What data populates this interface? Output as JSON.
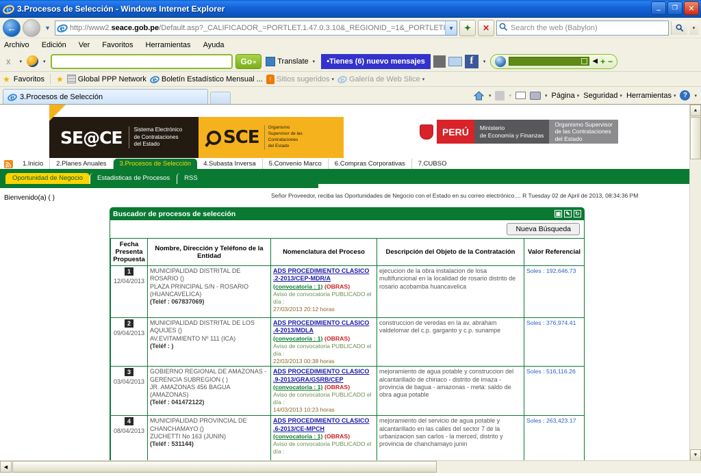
{
  "window": {
    "title": "3.Procesos de Selección - Windows Internet Explorer",
    "minimize": "—",
    "maximize": "❐",
    "close": "✕"
  },
  "address": {
    "url_prefix": "http://www2.",
    "url_domain": "seace.gob.pe",
    "url_suffix": "/Default.asp?_CALIFICADOR_=PORTLET.1.47.0.3.10&_REGIONID_=1&_PORTLETI",
    "refresh_glyph": "✦",
    "stop_glyph": "✕",
    "dropdown_glyph": "▼"
  },
  "search": {
    "placeholder": "Search the web (Babylon)",
    "go_glyph": "🔍",
    "dropdown_glyph": "▾"
  },
  "menubar": [
    "Archivo",
    "Edición",
    "Ver",
    "Favoritos",
    "Herramientas",
    "Ayuda"
  ],
  "babylon": {
    "close_label": "x",
    "input_value": "",
    "go_label": "Go",
    "go_chevron": "»",
    "translate_label": "Translate",
    "translate_caret": "▾",
    "messages_label": "•Tienes (6) nuevo mensajes",
    "facebook_label": "f",
    "facebook_caret": "▾",
    "speaker_glyph": "◀",
    "plus_label": "+",
    "minus_label": "−",
    "caret": "▾"
  },
  "favorites": {
    "label": "Favoritos",
    "items": [
      {
        "label": "Global PPP Network",
        "icon": "grid-icon"
      },
      {
        "label": "Boletín Estadístico Mensual ...",
        "icon": "ie-icon"
      },
      {
        "label": "Sitios sugeridos",
        "icon": "bulb-icon",
        "caret": "▾"
      },
      {
        "label": "Galería de Web Slice",
        "icon": "ie-icon",
        "caret": "▾"
      }
    ]
  },
  "tabstrip": {
    "tab_label": "3.Procesos de Selección",
    "commands": [
      {
        "label": "Página",
        "caret": "▾"
      },
      {
        "label": "Seguridad",
        "caret": "▾"
      },
      {
        "label": "Herramientas",
        "caret": "▾"
      }
    ],
    "overflow": "»",
    "help_glyph": "?",
    "caret": "▾"
  },
  "banner": {
    "seace_wordmark": "SE@CE",
    "seace_tagline": "Sistema Electrónico\nde Contrataciones\ndel Estado",
    "osce_wordmark": "SCE",
    "osce_tagline": "Organismo\nSupervisor de las\nContrataciones\ndel Estado",
    "peru_label": "PERÚ",
    "ministry_label": "Ministerio\nde Economía y Finanzas",
    "supervisor_label": "Organismo Supervisor\nde las Contrataciones\ndel Estado"
  },
  "nav": {
    "tabs": [
      {
        "label": "1.Inicio",
        "active": false
      },
      {
        "label": "2.Planes Anuales",
        "active": false
      },
      {
        "label": "3.Procesos de Selección",
        "active": true
      },
      {
        "label": "4.Subasta Inversa",
        "active": false
      },
      {
        "label": "5.Convenio Marco",
        "active": false
      },
      {
        "label": "6.Compras Corporativas",
        "active": false
      },
      {
        "label": "7.CUBSO",
        "active": false
      }
    ],
    "subtabs": [
      {
        "label": "Oportunidad de Negocio",
        "active": true
      },
      {
        "label": "Estadisticas de Procesos",
        "active": false
      },
      {
        "label": "RSS",
        "active": false
      }
    ]
  },
  "welcome": {
    "greeting": "Bienvenido(a) ( )",
    "marquee": "Señor Proveedor, reciba las Oportunidades de Negocio con el Estado en su correo electrónico.... R Tuesday 02 de April de 2013, 08:34:36 PM"
  },
  "panel": {
    "title": "Buscador de procesos de selección",
    "icons": [
      "minimize-panel-icon",
      "edit-panel-icon",
      "refresh-panel-icon"
    ],
    "new_search_label": "Nueva Búsqueda"
  },
  "table": {
    "headers": [
      "Fecha Presenta Propuesta",
      "Nombre, Dirección y Teléfono de la Entidad",
      "Nomenclatura del Proceso",
      "Descripción del Objeto de la Contratación",
      "Valor Referencial"
    ],
    "rows": [
      {
        "num": "1",
        "fecha": "12/04/2013",
        "entidad_nombre": "MUNICIPALIDAD DISTRITAL DE ROSARIO ()",
        "entidad_dir": "PLAZA PRINCIPAL S/N - ROSARIO (HUANCAVELICA)",
        "entidad_tel": "(Teléf : 067837069)",
        "nomenclatura": "ADS PROCEDIMIENTO CLASICO .2-2013/CEP-MDR/A",
        "convocatoria": "(convocatoria : 1)",
        "tipo": "(OBRAS)",
        "aviso": "Aviso de convocatoria PUBLICADO el día :",
        "aviso_fecha": "27/03/2013 20:12 horas",
        "descripcion": "ejecucion de la obra instalacion de losa multifuncional en la localidad de rosario distrito de rosario acobamba huancavelica",
        "valor": "Soles : 192,646.73"
      },
      {
        "num": "2",
        "fecha": "09/04/2013",
        "entidad_nombre": "MUNICIPALIDAD DISTRITAL DE LOS AQUIJES ()",
        "entidad_dir": "AV.EVITAMIENTO Nº 111 (ICA)",
        "entidad_tel": "(Teléf : )",
        "nomenclatura": "ADS PROCEDIMIENTO CLASICO .4-2013/MDLA",
        "convocatoria": "(convocatoria : 1)",
        "tipo": "(OBRAS)",
        "aviso": "Aviso de convocatoria PUBLICADO el día :",
        "aviso_fecha": "22/03/2013 00:38 horas",
        "descripcion": "construccion de veredas en la av. abraham valdelomar del c.p. garganto y c.p. sunampe",
        "valor": "Soles : 376,974.41"
      },
      {
        "num": "3",
        "fecha": "03/04/2013",
        "entidad_nombre": "GOBIERNO REGIONAL DE AMAZONAS - GERENCIA SUBREGION ( )",
        "entidad_dir": "JR. AMAZONAS 456 BAGUA (AMAZONAS)",
        "entidad_tel": "(Teléf : 041472122)",
        "nomenclatura": "ADS PROCEDIMIENTO CLASICO .9-2013/GRA/GSRB/CEP",
        "convocatoria": "(convocatoria : 1)",
        "tipo": "(OBRAS)",
        "aviso": "Aviso de convocatoria PUBLICADO el día :",
        "aviso_fecha": "14/03/2013 10:23 horas",
        "descripcion": "mejoramiento de agua potable y construccion del alcantarillado de chiriaco - distrito de imaza - provincia de bagua - amazonas - meta: saldo de obra agua potable",
        "valor": "Soles : 516,116.26"
      },
      {
        "num": "4",
        "fecha": "08/04/2013",
        "entidad_nombre": "MUNICIPALIDAD PROVINCIAL DE CHANCHAMAYO ()",
        "entidad_dir": "ZUCHETTI No 163 (JUNIN)",
        "entidad_tel": "(Teléf : 531144)",
        "nomenclatura": "ADS PROCEDIMIENTO CLASICO .6-2013/CE-MPCH",
        "convocatoria": "(convocatoria : 1)",
        "tipo": "(OBRAS)",
        "aviso": "Aviso de convocatoria PUBLICADO el día :",
        "aviso_fecha": "",
        "descripcion": "mejoramiento del servicio de agua potable y alcantarillado en las calles del sector 7 de la urbanizacion san carlos - la merced, distrito y provincia de chanchamayo junin",
        "valor": "Soles : 263,423.17"
      }
    ]
  },
  "colors": {
    "green": "#0a7a33",
    "yellow": "#ffd400",
    "osce_gold": "#f5b21c",
    "link_blue": "#1a1aa8"
  }
}
